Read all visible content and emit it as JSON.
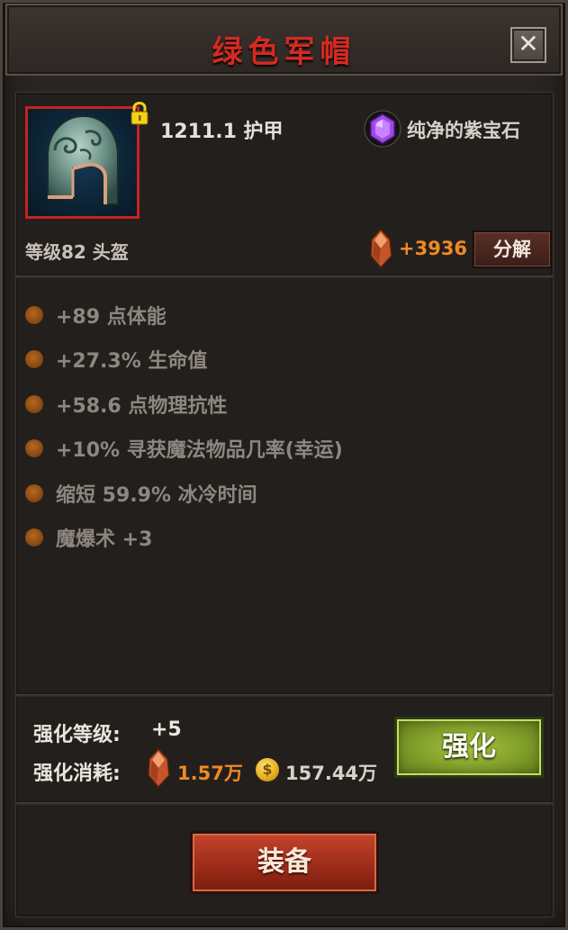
{
  "header": {
    "title": "绿色军帽",
    "close_icon": "close-icon"
  },
  "item": {
    "image_icon": "helmet-icon",
    "locked": true,
    "armor": "1211.1 护甲",
    "socket_gem": {
      "name": "纯净的紫宝石",
      "icon": "purple-gem-icon",
      "color": "#8b2fd6"
    },
    "level_type": "等级82  头盔",
    "salvage": {
      "value": "+3936",
      "button_label": "分解",
      "icon": "shard-icon"
    }
  },
  "stats": [
    "+89 点体能",
    "+27.3% 生命值",
    "+58.6 点物理抗性",
    "+10% 寻获魔法物品几率(幸运)",
    "缩短 59.9% 冰冷时间",
    "魔爆术 +3"
  ],
  "enhance": {
    "level_label": "强化等级:",
    "level_value": "+5",
    "cost_label": "强化消耗:",
    "shard_cost": "1.57万",
    "coin_symbol": "$",
    "gold_cost": "157.44万",
    "button_label": "强化"
  },
  "equip_button_label": "装备",
  "colors": {
    "title_red": "#d42a21",
    "accent_orange": "#f08a24",
    "enhance_green": "#809d2a",
    "equip_red": "#9a2a18",
    "stat_text": "#8d8780"
  }
}
